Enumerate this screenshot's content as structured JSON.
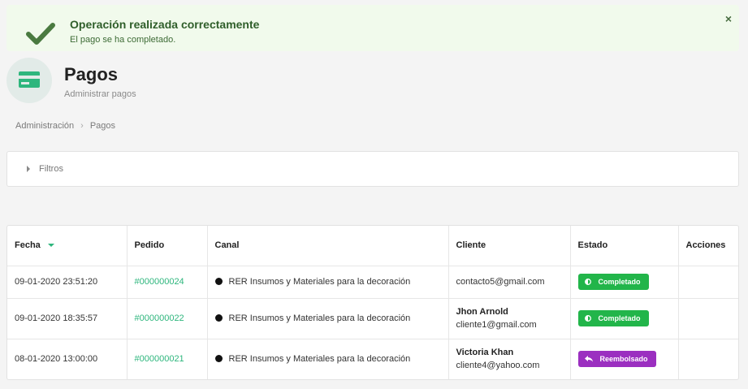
{
  "alert": {
    "title": "Operación realizada correctamente",
    "message": "El pago se ha completado.",
    "close": "×",
    "color": "#2f5e2a",
    "background": "#f1faec"
  },
  "header": {
    "title": "Pagos",
    "subtitle": "Administrar pagos",
    "icon": "credit-card-icon"
  },
  "breadcrumb": {
    "items": [
      "Administración",
      "Pagos"
    ],
    "separator": "›"
  },
  "filters": {
    "label": "Filtros"
  },
  "table": {
    "columns": [
      "Fecha",
      "Pedido",
      "Canal",
      "Cliente",
      "Estado",
      "Acciones"
    ],
    "sorted_column": "Fecha",
    "rows": [
      {
        "date": "09-01-2020 23:51:20",
        "order": "#000000024",
        "channel": "RER Insumos y Materiales para la decoración",
        "client_name": "",
        "client_email": "contacto5@gmail.com",
        "status": "Completado"
      },
      {
        "date": "09-01-2020 18:35:57",
        "order": "#000000022",
        "channel": "RER Insumos y Materiales para la decoración",
        "client_name": "Jhon Arnold",
        "client_email": "cliente1@gmail.com",
        "status": "Completado"
      },
      {
        "date": "08-01-2020 13:00:00",
        "order": "#000000021",
        "channel": "RER Insumos y Materiales para la decoración",
        "client_name": "Victoria Khan",
        "client_email": "cliente4@yahoo.com",
        "status": "Reembolsado"
      }
    ]
  },
  "colors": {
    "accent": "#2eb67d",
    "completed": "#22b54a",
    "refunded": "#9b2fc0"
  }
}
